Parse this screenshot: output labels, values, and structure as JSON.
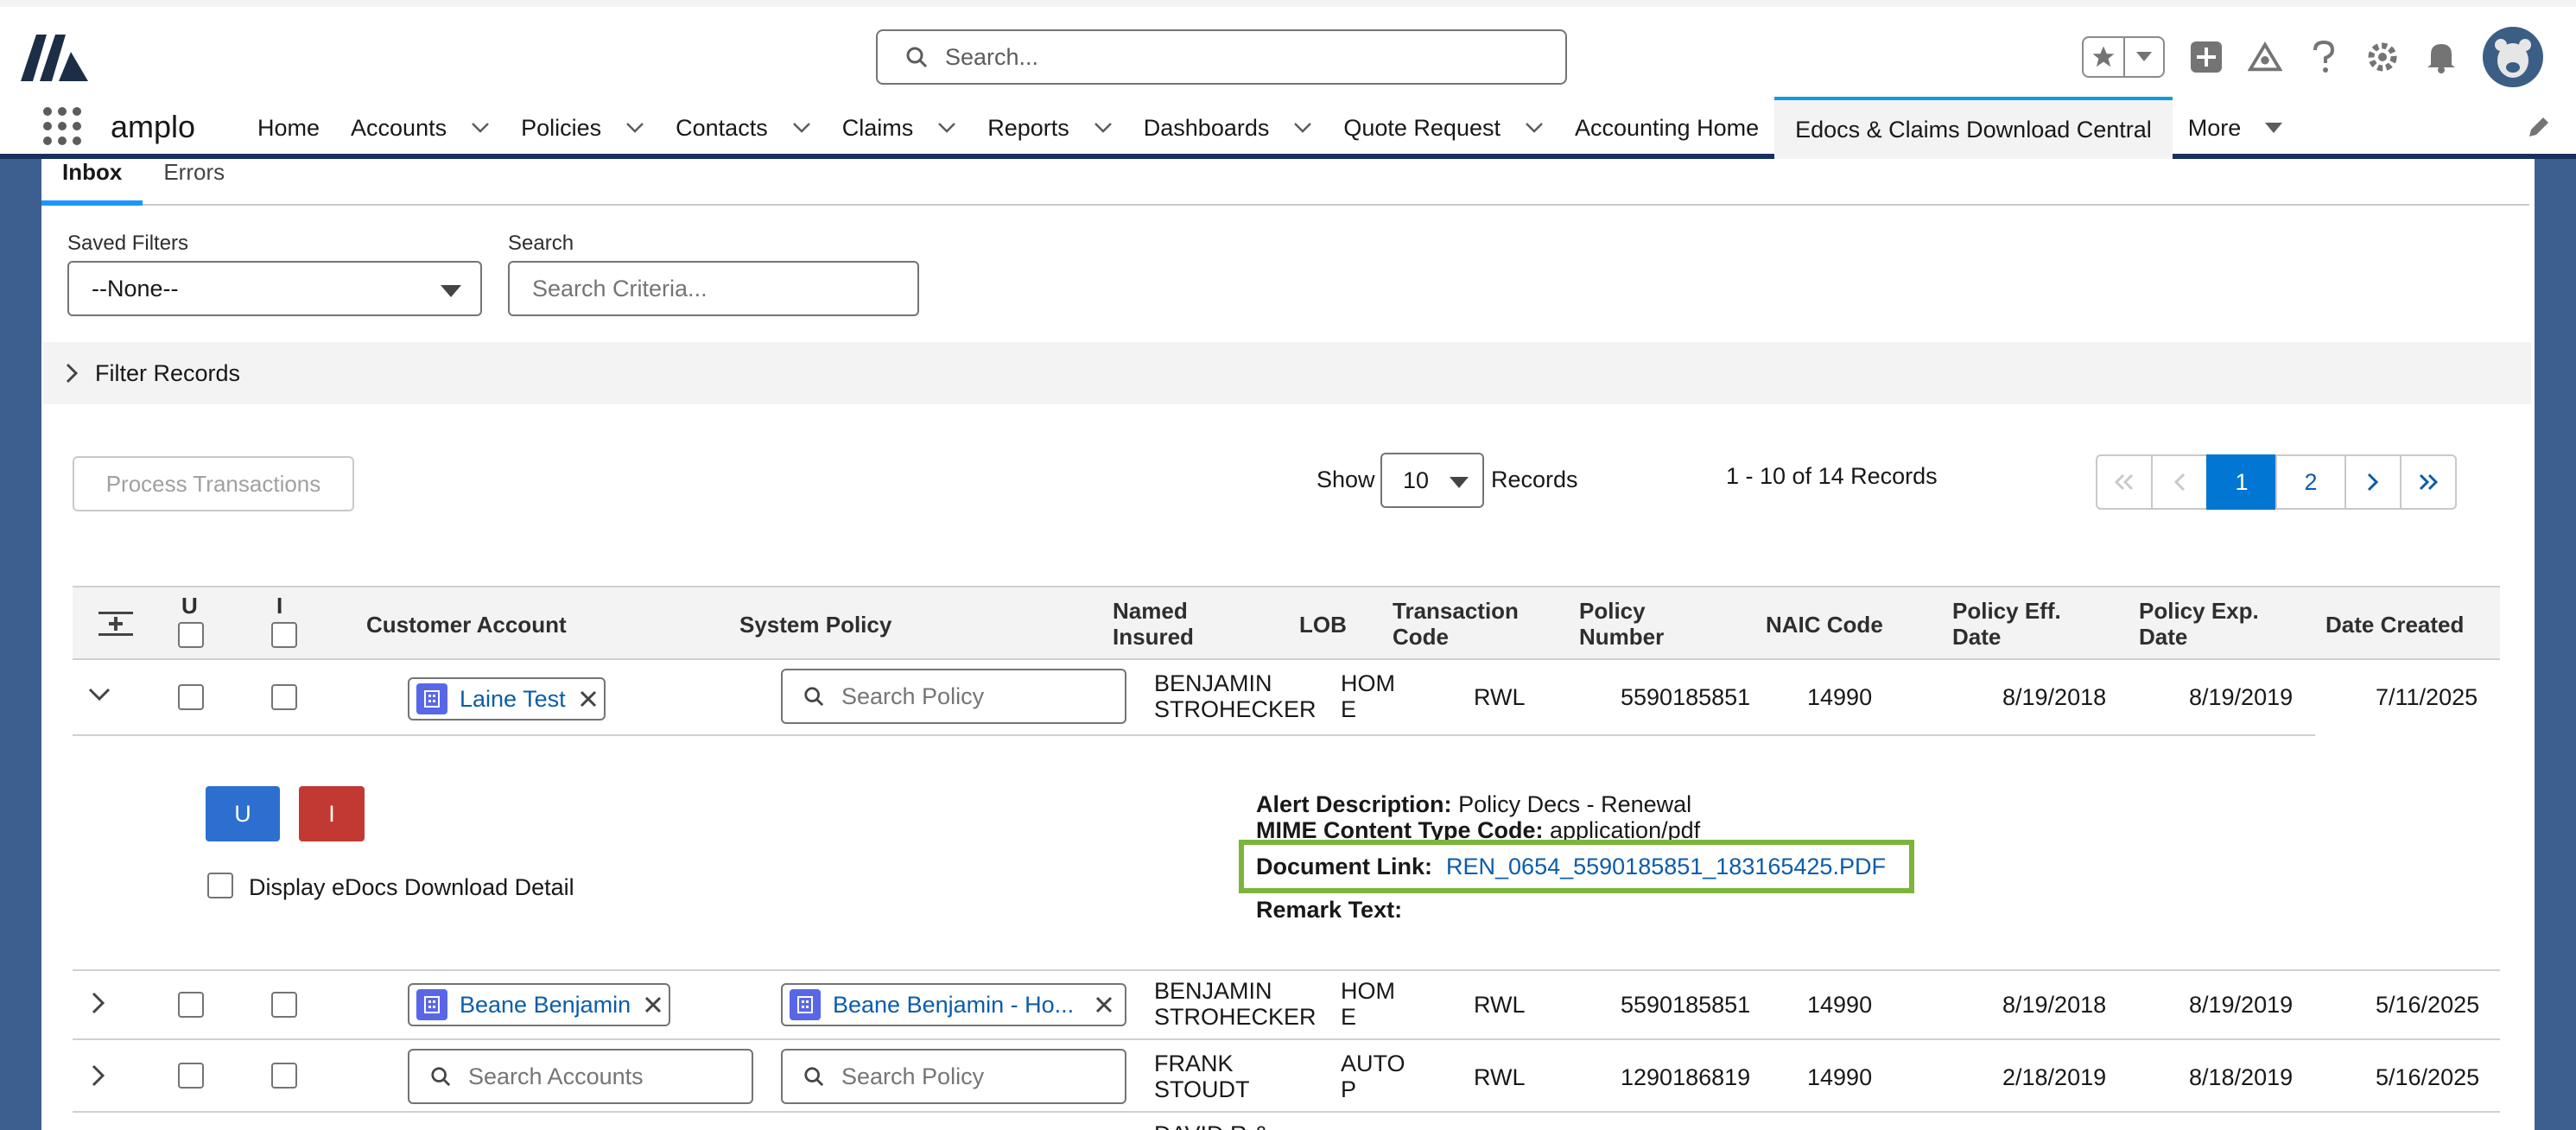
{
  "header": {
    "search_placeholder": "Search...",
    "icons": [
      "star-icon",
      "chevron-down-icon",
      "add-icon",
      "trailhead-icon",
      "help-icon",
      "gear-icon",
      "bell-icon",
      "avatar-icon"
    ]
  },
  "nav": {
    "app_name": "amplo",
    "items": [
      {
        "label": "Home",
        "has_menu": false
      },
      {
        "label": "Accounts",
        "has_menu": true
      },
      {
        "label": "Policies",
        "has_menu": true
      },
      {
        "label": "Contacts",
        "has_menu": true
      },
      {
        "label": "Claims",
        "has_menu": true
      },
      {
        "label": "Reports",
        "has_menu": true
      },
      {
        "label": "Dashboards",
        "has_menu": true
      },
      {
        "label": "Quote Request",
        "has_menu": true
      },
      {
        "label": "Accounting Home",
        "has_menu": false
      },
      {
        "label": "Edocs & Claims Download Central",
        "has_menu": false,
        "active": true
      },
      {
        "label": "More",
        "has_menu": true
      }
    ]
  },
  "subtabs": [
    {
      "label": "Inbox",
      "active": true
    },
    {
      "label": "Errors",
      "active": false
    }
  ],
  "filters": {
    "saved_filters_label": "Saved Filters",
    "saved_filters_value": "--None--",
    "search_label": "Search",
    "search_placeholder": "Search Criteria...",
    "filter_records_label": "Filter Records"
  },
  "toolbar": {
    "process_label": "Process Transactions",
    "show_label": "Show",
    "show_value": "10",
    "records_label": "Records",
    "range_text": "1 - 10 of 14 Records",
    "pages": [
      "1",
      "2"
    ],
    "current_page": "1"
  },
  "table": {
    "columns": {
      "u": "U",
      "i": "I",
      "customer_account": "Customer Account",
      "system_policy": "System Policy",
      "named_insured_1": "Named",
      "named_insured_2": "Insured",
      "lob": "LOB",
      "transaction_code_1": "Transaction",
      "transaction_code_2": "Code",
      "policy_number_1": "Policy",
      "policy_number_2": "Number",
      "naic_code": "NAIC Code",
      "policy_eff_1": "Policy Eff.",
      "policy_eff_2": "Date",
      "policy_exp_1": "Policy Exp.",
      "policy_exp_2": "Date",
      "date_created": "Date Created"
    },
    "rows": [
      {
        "customer_account": "Laine Test",
        "system_policy_placeholder": "Search Policy",
        "named_insured_1": "BENJAMIN",
        "named_insured_2": "STROHECKER",
        "lob_1": "HOM",
        "lob_2": "E",
        "transaction_code": "RWL",
        "policy_number": "5590185851",
        "naic_code": "14990",
        "policy_eff": "8/19/2018",
        "policy_exp": "8/19/2019",
        "date_created": "7/11/2025",
        "expanded": true
      },
      {
        "customer_account": "Beane Benjamin",
        "system_policy": "Beane Benjamin - Ho...",
        "named_insured_1": "BENJAMIN",
        "named_insured_2": "STROHECKER",
        "lob_1": "HOM",
        "lob_2": "E",
        "transaction_code": "RWL",
        "policy_number": "5590185851",
        "naic_code": "14990",
        "policy_eff": "8/19/2018",
        "policy_exp": "8/19/2019",
        "date_created": "5/16/2025"
      },
      {
        "customer_account_placeholder": "Search Accounts",
        "system_policy_placeholder": "Search Policy",
        "named_insured_1": "FRANK",
        "named_insured_2": "STOUDT",
        "lob_1": "AUTO",
        "lob_2": "P",
        "transaction_code": "RWL",
        "policy_number": "1290186819",
        "naic_code": "14990",
        "policy_eff": "2/18/2019",
        "policy_exp": "8/18/2019",
        "date_created": "5/16/2025"
      },
      {
        "named_insured_1": "DAVID R &"
      }
    ]
  },
  "detail": {
    "u_button": "U",
    "i_button": "I",
    "display_detail_label": "Display eDocs Download Detail",
    "alert_description_label": "Alert Description:",
    "alert_description_value": "Policy Decs - Renewal",
    "mime_label": "MIME Content Type Code:",
    "mime_value": "application/pdf",
    "document_link_label": "Document Link:",
    "document_link_value": "REN_0654_5590185851_183165425.PDF",
    "remark_label": "Remark Text:"
  },
  "colors": {
    "brand_nav_border": "#16325c",
    "active_tab": "#1b96ff",
    "primary_button": "#2d6fcf",
    "destructive_button": "#c23934",
    "highlight_box": "#7db53c",
    "link": "#0b5cab"
  }
}
